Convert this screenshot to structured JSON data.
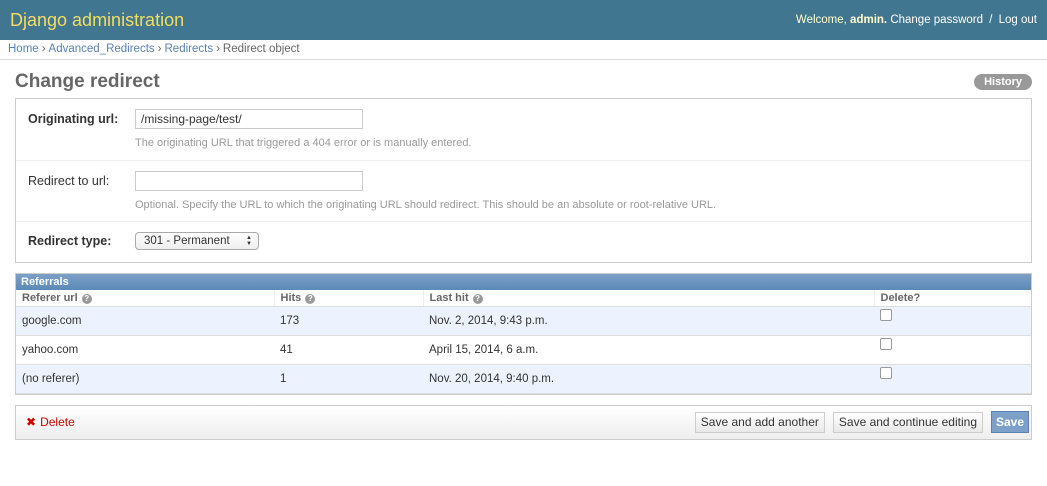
{
  "header": {
    "site_name": "Django administration",
    "welcome": "Welcome,",
    "username": "admin.",
    "change_password": "Change password",
    "separator": "/",
    "logout": "Log out"
  },
  "breadcrumbs": {
    "home": "Home",
    "app": "Advanced_Redirects",
    "model": "Redirects",
    "current": "Redirect object",
    "sep": "›"
  },
  "page": {
    "title": "Change redirect",
    "history_label": "History"
  },
  "form": {
    "originating_url": {
      "label": "Originating url:",
      "value": "/missing-page/test/",
      "help": "The originating URL that triggered a 404 error or is manually entered."
    },
    "redirect_to_url": {
      "label": "Redirect to url:",
      "value": "",
      "help": "Optional. Specify the URL to which the originating URL should redirect. This should be an absolute or root-relative URL."
    },
    "redirect_type": {
      "label": "Redirect type:",
      "selected": "301 - Permanent"
    }
  },
  "referrals": {
    "title": "Referrals",
    "columns": [
      "Referer url",
      "Hits",
      "Last hit",
      "Delete?"
    ],
    "rows": [
      {
        "url": "google.com",
        "hits": "173",
        "last_hit": "Nov. 2, 2014, 9:43 p.m."
      },
      {
        "url": "yahoo.com",
        "hits": "41",
        "last_hit": "April 15, 2014, 6 a.m."
      },
      {
        "url": "(no referer)",
        "hits": "1",
        "last_hit": "Nov. 20, 2014, 9:40 p.m."
      }
    ]
  },
  "submit": {
    "delete": "Delete",
    "save_add": "Save and add another",
    "save_continue": "Save and continue editing",
    "save": "Save"
  },
  "icons": {
    "help": "question-mark-icon",
    "delete": "x-icon",
    "select": "up-down-arrows-icon"
  },
  "colors": {
    "header_bg": "#417690",
    "site_name": "#f5dd5d",
    "link": "#5b80b2",
    "delete": "#cc0000",
    "save_button": "#7ca0c7",
    "row_alt": "#edf3fe"
  }
}
